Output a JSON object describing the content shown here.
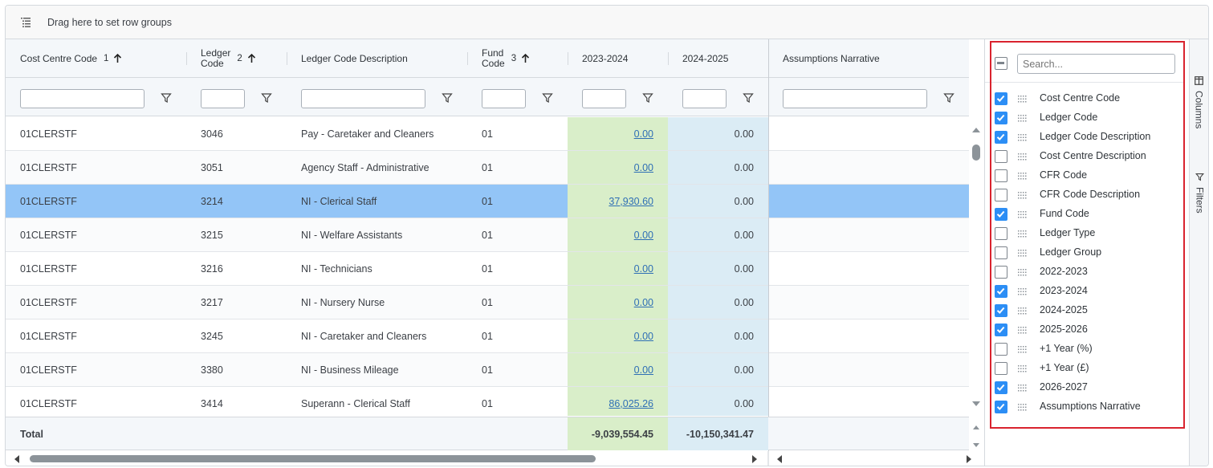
{
  "group_bar": {
    "text": "Drag here to set row groups"
  },
  "columns": [
    {
      "label": "Cost Centre Code",
      "sort_index": "1"
    },
    {
      "label": "Ledger\nCode",
      "sort_index": "2"
    },
    {
      "label": "Ledger Code Description"
    },
    {
      "label": "Fund\nCode",
      "sort_index": "3"
    },
    {
      "label": "2023-2024"
    },
    {
      "label": "2024-2025"
    },
    {
      "label": "Assumptions Narrative"
    }
  ],
  "rows": [
    {
      "cc": "01CLERSTF",
      "ledger": "3046",
      "desc": "Pay - Caretaker and Cleaners",
      "fund": "01",
      "y2324": "0.00",
      "y2425": "0.00",
      "narr": ""
    },
    {
      "cc": "01CLERSTF",
      "ledger": "3051",
      "desc": "Agency Staff - Administrative",
      "fund": "01",
      "y2324": "0.00",
      "y2425": "0.00",
      "narr": ""
    },
    {
      "cc": "01CLERSTF",
      "ledger": "3214",
      "desc": "NI - Clerical Staff",
      "fund": "01",
      "y2324": "37,930.60",
      "y2425": "0.00",
      "narr": "",
      "selected": true
    },
    {
      "cc": "01CLERSTF",
      "ledger": "3215",
      "desc": "NI - Welfare Assistants",
      "fund": "01",
      "y2324": "0.00",
      "y2425": "0.00",
      "narr": ""
    },
    {
      "cc": "01CLERSTF",
      "ledger": "3216",
      "desc": "NI - Technicians",
      "fund": "01",
      "y2324": "0.00",
      "y2425": "0.00",
      "narr": ""
    },
    {
      "cc": "01CLERSTF",
      "ledger": "3217",
      "desc": "NI - Nursery Nurse",
      "fund": "01",
      "y2324": "0.00",
      "y2425": "0.00",
      "narr": ""
    },
    {
      "cc": "01CLERSTF",
      "ledger": "3245",
      "desc": "NI - Caretaker and Cleaners",
      "fund": "01",
      "y2324": "0.00",
      "y2425": "0.00",
      "narr": ""
    },
    {
      "cc": "01CLERSTF",
      "ledger": "3380",
      "desc": "NI - Business Mileage",
      "fund": "01",
      "y2324": "0.00",
      "y2425": "0.00",
      "narr": ""
    },
    {
      "cc": "01CLERSTF",
      "ledger": "3414",
      "desc": "Superann - Clerical Staff",
      "fund": "01",
      "y2324": "86,025.26",
      "y2425": "0.00",
      "narr": ""
    }
  ],
  "total": {
    "label": "Total",
    "y2324": "-9,039,554.45",
    "y2425": "-10,150,341.47"
  },
  "panel": {
    "search_placeholder": "Search...",
    "items": [
      {
        "label": "Cost Centre Code",
        "checked": true
      },
      {
        "label": "Ledger Code",
        "checked": true
      },
      {
        "label": "Ledger Code Description",
        "checked": true
      },
      {
        "label": "Cost Centre Description",
        "checked": false
      },
      {
        "label": "CFR Code",
        "checked": false
      },
      {
        "label": "CFR Code Description",
        "checked": false
      },
      {
        "label": "Fund Code",
        "checked": true
      },
      {
        "label": "Ledger Type",
        "checked": false
      },
      {
        "label": "Ledger Group",
        "checked": false
      },
      {
        "label": "2022-2023",
        "checked": false
      },
      {
        "label": "2023-2024",
        "checked": true
      },
      {
        "label": "2024-2025",
        "checked": true
      },
      {
        "label": "2025-2026",
        "checked": true
      },
      {
        "label": "+1 Year (%)",
        "checked": false
      },
      {
        "label": "+1 Year (£)",
        "checked": false
      },
      {
        "label": "2026-2027",
        "checked": true
      },
      {
        "label": "Assumptions Narrative",
        "checked": true
      }
    ]
  },
  "tabs": {
    "columns": "Columns",
    "filters": "Filters"
  },
  "colors": {
    "accent": "#2c8ef5",
    "selected_row": "#93c5f7",
    "green_col": "#d9eec9",
    "blue_col": "#dbecf5",
    "highlight_border": "#d9232e"
  }
}
